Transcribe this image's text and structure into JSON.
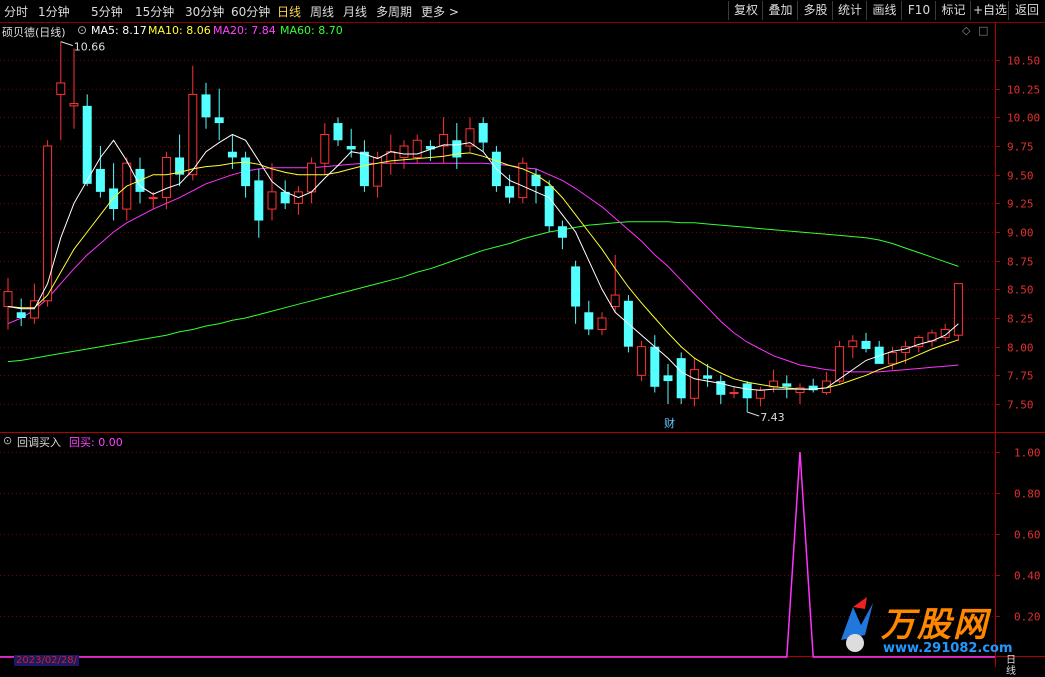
{
  "topbar": {
    "period_tabs": [
      "分时",
      "1分钟",
      "5分钟",
      "15分钟",
      "30分钟",
      "60分钟",
      "日线",
      "周线",
      "月线",
      "多周期",
      "更多 >"
    ],
    "active_tab": "日线",
    "right_buttons": [
      "复权",
      "叠加",
      "多股",
      "统计",
      "画线",
      "F10",
      "标记",
      "+自选",
      "返回"
    ]
  },
  "legend": {
    "stock_name": "硕贝德(日线)",
    "ma5": "MA5: 8.17",
    "ma10": "MA10: 8.06",
    "ma20": "MA20: 7.84",
    "ma60": "MA60: 8.70",
    "colors": {
      "ma5": "#ffffff",
      "ma10": "#ffff33",
      "ma20": "#ff33ff",
      "ma60": "#33ff33",
      "up": "#ff3333",
      "down": "#54ffff"
    }
  },
  "indicator": {
    "name": "回调买入",
    "value_label": "回买: 0.00",
    "axis": [
      "1.00",
      "0.80",
      "0.60",
      "0.40",
      "0.20"
    ]
  },
  "price_axis": [
    "10.50",
    "10.25",
    "10.00",
    "9.75",
    "9.50",
    "9.25",
    "9.00",
    "8.75",
    "8.50",
    "8.25",
    "8.00",
    "7.75",
    "7.50"
  ],
  "annotations": {
    "high": "10.66",
    "low": "7.43",
    "cai": "财"
  },
  "bottom": {
    "date": "2023/02/28/",
    "period": "日线"
  },
  "watermark": {
    "brand": "万股网",
    "url": "www.291082.com"
  },
  "chart_data": {
    "type": "candlestick",
    "ylim": [
      7.35,
      10.75
    ],
    "candles": [
      [
        8.35,
        8.6,
        8.15,
        8.48
      ],
      [
        8.3,
        8.42,
        8.18,
        8.25
      ],
      [
        8.25,
        8.55,
        8.2,
        8.4
      ],
      [
        8.4,
        9.8,
        8.35,
        9.75
      ],
      [
        10.2,
        10.66,
        9.8,
        10.3
      ],
      [
        10.1,
        10.6,
        9.9,
        10.12
      ],
      [
        10.1,
        10.2,
        9.4,
        9.42
      ],
      [
        9.55,
        9.75,
        9.3,
        9.35
      ],
      [
        9.38,
        9.6,
        9.1,
        9.2
      ],
      [
        9.2,
        9.65,
        9.1,
        9.6
      ],
      [
        9.55,
        9.65,
        9.25,
        9.35
      ],
      [
        9.3,
        9.35,
        9.2,
        9.3
      ],
      [
        9.3,
        9.7,
        9.2,
        9.65
      ],
      [
        9.65,
        9.85,
        9.4,
        9.5
      ],
      [
        9.5,
        10.45,
        9.45,
        10.2
      ],
      [
        10.2,
        10.3,
        9.9,
        10.0
      ],
      [
        10.0,
        10.25,
        9.8,
        9.95
      ],
      [
        9.7,
        9.85,
        9.55,
        9.65
      ],
      [
        9.65,
        9.7,
        9.3,
        9.4
      ],
      [
        9.45,
        9.55,
        8.95,
        9.1
      ],
      [
        9.2,
        9.6,
        9.1,
        9.35
      ],
      [
        9.35,
        9.45,
        9.2,
        9.25
      ],
      [
        9.25,
        9.4,
        9.15,
        9.35
      ],
      [
        9.35,
        9.65,
        9.25,
        9.6
      ],
      [
        9.6,
        9.95,
        9.5,
        9.85
      ],
      [
        9.95,
        10.0,
        9.75,
        9.8
      ],
      [
        9.75,
        9.9,
        9.65,
        9.72
      ],
      [
        9.7,
        9.8,
        9.35,
        9.4
      ],
      [
        9.4,
        9.7,
        9.3,
        9.65
      ],
      [
        9.6,
        9.85,
        9.5,
        9.7
      ],
      [
        9.65,
        9.8,
        9.55,
        9.75
      ],
      [
        9.65,
        9.85,
        9.6,
        9.8
      ],
      [
        9.75,
        9.8,
        9.62,
        9.72
      ],
      [
        9.75,
        10.0,
        9.6,
        9.85
      ],
      [
        9.8,
        9.95,
        9.55,
        9.65
      ],
      [
        9.75,
        10.0,
        9.7,
        9.9
      ],
      [
        9.95,
        10.0,
        9.7,
        9.78
      ],
      [
        9.7,
        9.75,
        9.35,
        9.4
      ],
      [
        9.4,
        9.5,
        9.25,
        9.3
      ],
      [
        9.3,
        9.65,
        9.25,
        9.6
      ],
      [
        9.5,
        9.55,
        9.25,
        9.4
      ],
      [
        9.4,
        9.45,
        9.0,
        9.05
      ],
      [
        9.05,
        9.1,
        8.85,
        8.95
      ],
      [
        8.7,
        8.75,
        8.2,
        8.35
      ],
      [
        8.3,
        8.4,
        8.1,
        8.15
      ],
      [
        8.15,
        8.3,
        8.1,
        8.25
      ],
      [
        8.35,
        8.8,
        8.3,
        8.45
      ],
      [
        8.4,
        8.45,
        7.95,
        8.0
      ],
      [
        7.75,
        8.05,
        7.7,
        8.0
      ],
      [
        8.0,
        8.1,
        7.6,
        7.65
      ],
      [
        7.75,
        7.85,
        7.5,
        7.7
      ],
      [
        7.9,
        7.95,
        7.5,
        7.55
      ],
      [
        7.55,
        7.9,
        7.48,
        7.8
      ],
      [
        7.75,
        7.85,
        7.65,
        7.72
      ],
      [
        7.7,
        7.75,
        7.5,
        7.58
      ],
      [
        7.6,
        7.65,
        7.55,
        7.6
      ],
      [
        7.68,
        7.7,
        7.43,
        7.55
      ],
      [
        7.55,
        7.65,
        7.48,
        7.62
      ],
      [
        7.65,
        7.8,
        7.6,
        7.7
      ],
      [
        7.68,
        7.75,
        7.55,
        7.65
      ],
      [
        7.6,
        7.68,
        7.5,
        7.64
      ],
      [
        7.66,
        7.72,
        7.6,
        7.62
      ],
      [
        7.6,
        7.78,
        7.58,
        7.7
      ],
      [
        7.7,
        8.05,
        7.68,
        8.0
      ],
      [
        8.0,
        8.1,
        7.9,
        8.05
      ],
      [
        8.05,
        8.12,
        7.95,
        7.98
      ],
      [
        8.0,
        8.05,
        7.85,
        7.85
      ],
      [
        7.85,
        8.0,
        7.8,
        7.95
      ],
      [
        7.95,
        8.05,
        7.85,
        8.0
      ],
      [
        8.0,
        8.1,
        7.95,
        8.08
      ],
      [
        8.05,
        8.15,
        8.0,
        8.12
      ],
      [
        8.08,
        8.2,
        8.05,
        8.15
      ],
      [
        8.1,
        8.55,
        8.05,
        8.55
      ]
    ],
    "ma5": [
      8.35,
      8.33,
      8.33,
      8.55,
      8.95,
      9.25,
      9.45,
      9.65,
      9.8,
      9.62,
      9.4,
      9.33,
      9.38,
      9.42,
      9.54,
      9.7,
      9.78,
      9.85,
      9.8,
      9.62,
      9.44,
      9.35,
      9.3,
      9.35,
      9.47,
      9.58,
      9.7,
      9.68,
      9.64,
      9.7,
      9.68,
      9.68,
      9.72,
      9.76,
      9.76,
      9.78,
      9.7,
      9.55,
      9.45,
      9.4,
      9.35,
      9.3,
      9.15,
      9.0,
      8.75,
      8.5,
      8.3,
      8.2,
      8.1,
      8.0,
      7.9,
      7.78,
      7.72,
      7.7,
      7.68,
      7.65,
      7.63,
      7.62,
      7.63,
      7.63,
      7.63,
      7.63,
      7.64,
      7.72,
      7.8,
      7.88,
      7.92,
      7.96,
      7.98,
      8.02,
      8.05,
      8.1,
      8.2
    ],
    "ma10": [
      8.35,
      8.34,
      8.34,
      8.45,
      8.65,
      8.85,
      9.0,
      9.15,
      9.3,
      9.4,
      9.45,
      9.5,
      9.5,
      9.52,
      9.55,
      9.57,
      9.58,
      9.6,
      9.61,
      9.59,
      9.55,
      9.52,
      9.5,
      9.5,
      9.5,
      9.52,
      9.55,
      9.58,
      9.6,
      9.62,
      9.63,
      9.64,
      9.65,
      9.66,
      9.68,
      9.69,
      9.66,
      9.62,
      9.58,
      9.55,
      9.5,
      9.42,
      9.3,
      9.15,
      9.0,
      8.85,
      8.68,
      8.52,
      8.38,
      8.25,
      8.12,
      8.0,
      7.9,
      7.83,
      7.77,
      7.72,
      7.69,
      7.67,
      7.65,
      7.64,
      7.63,
      7.63,
      7.64,
      7.67,
      7.71,
      7.75,
      7.8,
      7.84,
      7.88,
      7.93,
      7.98,
      8.02,
      8.06
    ],
    "ma20": [
      8.2,
      8.25,
      8.32,
      8.42,
      8.55,
      8.68,
      8.8,
      8.9,
      9.0,
      9.08,
      9.14,
      9.2,
      9.25,
      9.3,
      9.36,
      9.42,
      9.46,
      9.5,
      9.53,
      9.55,
      9.56,
      9.56,
      9.56,
      9.56,
      9.57,
      9.58,
      9.59,
      9.6,
      9.6,
      9.6,
      9.6,
      9.6,
      9.6,
      9.6,
      9.6,
      9.6,
      9.6,
      9.59,
      9.58,
      9.56,
      9.55,
      9.5,
      9.45,
      9.38,
      9.3,
      9.22,
      9.12,
      9.02,
      8.92,
      8.8,
      8.7,
      8.58,
      8.46,
      8.34,
      8.22,
      8.12,
      8.04,
      7.98,
      7.92,
      7.88,
      7.84,
      7.82,
      7.8,
      7.79,
      7.78,
      7.78,
      7.78,
      7.79,
      7.8,
      7.81,
      7.82,
      7.83,
      7.84
    ],
    "ma60": [
      7.87,
      7.88,
      7.9,
      7.92,
      7.94,
      7.96,
      7.98,
      8.0,
      8.02,
      8.04,
      8.06,
      8.08,
      8.1,
      8.13,
      8.15,
      8.18,
      8.2,
      8.23,
      8.25,
      8.28,
      8.31,
      8.34,
      8.37,
      8.4,
      8.43,
      8.46,
      8.49,
      8.52,
      8.55,
      8.58,
      8.61,
      8.65,
      8.68,
      8.72,
      8.76,
      8.8,
      8.84,
      8.87,
      8.9,
      8.94,
      8.97,
      9.0,
      9.02,
      9.04,
      9.06,
      9.07,
      9.08,
      9.09,
      9.09,
      9.09,
      9.09,
      9.08,
      9.08,
      9.07,
      9.06,
      9.05,
      9.04,
      9.03,
      9.02,
      9.01,
      9.0,
      8.99,
      8.98,
      8.97,
      8.96,
      8.95,
      8.93,
      8.9,
      8.86,
      8.82,
      8.78,
      8.74,
      8.7
    ],
    "indicator_values": [
      0,
      0,
      0,
      0,
      0,
      0,
      0,
      0,
      0,
      0,
      0,
      0,
      0,
      0,
      0,
      0,
      0,
      0,
      0,
      0,
      0,
      0,
      0,
      0,
      0,
      0,
      0,
      0,
      0,
      0,
      0,
      0,
      0,
      0,
      0,
      0,
      0,
      0,
      0,
      0,
      0,
      0,
      0,
      0,
      0,
      0,
      0,
      0,
      0,
      0,
      0,
      0,
      0,
      0,
      0,
      0,
      0,
      0,
      0,
      0,
      1,
      0,
      0,
      0,
      0,
      0,
      0,
      0,
      0,
      0,
      0,
      0,
      0
    ],
    "indicator_ylim": [
      0,
      1.0
    ]
  }
}
